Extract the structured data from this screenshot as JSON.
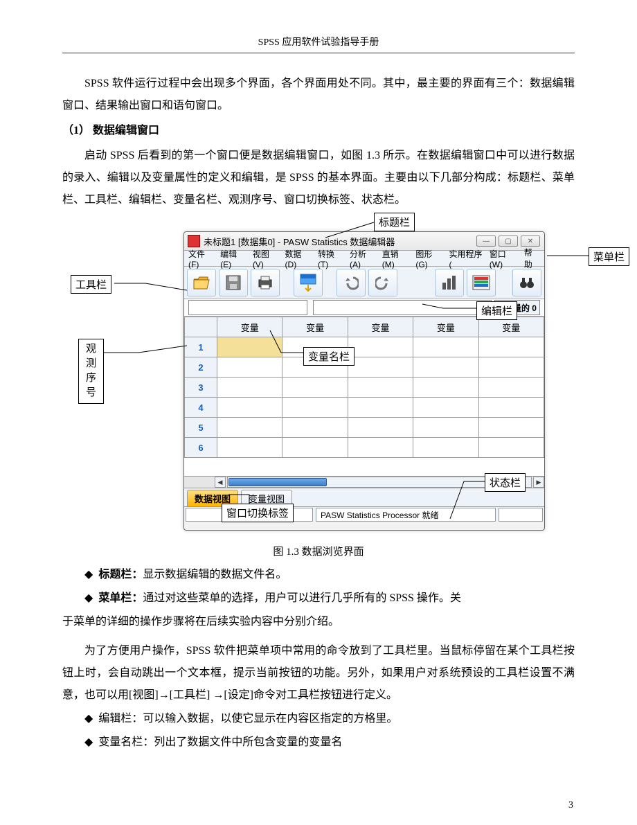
{
  "doc_header": "SPSS 应用软件试验指导手册",
  "para1": "SPSS 软件运行过程中会出现多个界面，各个界面用处不同。其中，最主要的界面有三个：数据编辑窗口、结果输出窗口和语句窗口。",
  "section1": "（1） 数据编辑窗口",
  "para2": "启动 SPSS 后看到的第一个窗口便是数据编辑窗口，如图 1.3 所示。在数据编辑窗口中可以进行数据的录入、编辑以及变量属性的定义和编辑，是 SPSS 的基本界面。主要由以下几部分构成：标题栏、菜单栏、工具栏、编辑栏、变量名栏、观测序号、窗口切换标签、状态栏。",
  "caption": "图 1.3  数据浏览界面",
  "labels": {
    "titlebar": "标题栏",
    "menubar": "菜单栏",
    "toolbar": "工具栏",
    "editbar": "编辑栏",
    "varname": "变量名栏",
    "rownum": "观\n测\n序\n号",
    "tabs": "窗口切换标签",
    "status": "状态栏"
  },
  "win": {
    "title": "未标题1 [数据集0] - PASW Statistics 数据编辑器",
    "menus": [
      "文件(F)",
      "编辑(E)",
      "视图(V)",
      "数据(D)",
      "转换(T)",
      "分析(A)",
      "直销(M)",
      "图形(G)",
      "实用程序(",
      "窗口(W)",
      "帮助"
    ],
    "varcount": "0 变量的 0",
    "colhdr": "变量",
    "rows": [
      "1",
      "2",
      "3",
      "4",
      "5",
      "6"
    ],
    "tab_data": "数据视图",
    "tab_var": "变量视图",
    "status_text": "PASW Statistics Processor 就绪"
  },
  "bullets": [
    {
      "b": "标题栏：",
      "t": "显示数据编辑的数据文件名。"
    },
    {
      "b": "菜单栏：",
      "t": "通过对这些菜单的选择，用户可以进行几乎所有的 SPSS 操作。关"
    }
  ],
  "para3_cont": "于菜单的详细的操作步骤将在后续实验内容中分别介绍。",
  "para4": "为了方便用户操作，SPSS 软件把菜单项中常用的命令放到了工具栏里。当鼠标停留在某个工具栏按钮上时，会自动跳出一个文本框，提示当前按钮的功能。另外，如果用户对系统预设的工具栏设置不满意，也可以用[视图]→[工具栏] →[设定]命令对工具栏按钮进行定义。",
  "bullets2": [
    {
      "t": "编辑栏：可以输入数据，以使它显示在内容区指定的方格里。"
    },
    {
      "t": "变量名栏：列出了数据文件中所包含变量的变量名"
    }
  ],
  "page_num": "3"
}
